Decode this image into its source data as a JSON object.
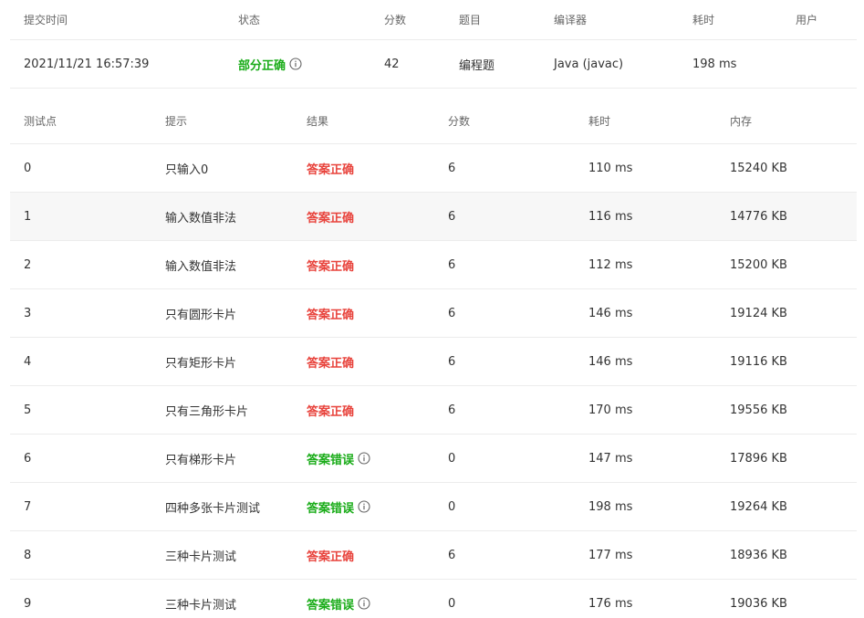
{
  "summary": {
    "headers": {
      "submit_time": "提交时间",
      "status": "状态",
      "score": "分数",
      "problem": "题目",
      "compiler": "编译器",
      "time": "耗时",
      "user": "用户"
    },
    "row": {
      "submit_time": "2021/11/21 16:57:39",
      "status": "部分正确",
      "score": "42",
      "problem": "编程题",
      "compiler": "Java (javac)",
      "time": "198 ms",
      "user": ""
    }
  },
  "cases": {
    "headers": {
      "id": "测试点",
      "hint": "提示",
      "result": "结果",
      "score": "分数",
      "time": "耗时",
      "memory": "内存"
    },
    "rows": [
      {
        "id": "0",
        "hint": "只输入0",
        "result": "答案正确",
        "score": "6",
        "time": "110 ms",
        "memory": "15240 KB"
      },
      {
        "id": "1",
        "hint": "输入数值非法",
        "result": "答案正确",
        "score": "6",
        "time": "116 ms",
        "memory": "14776 KB"
      },
      {
        "id": "2",
        "hint": "输入数值非法",
        "result": "答案正确",
        "score": "6",
        "time": "112 ms",
        "memory": "15200 KB"
      },
      {
        "id": "3",
        "hint": "只有圆形卡片",
        "result": "答案正确",
        "score": "6",
        "time": "146 ms",
        "memory": "19124 KB"
      },
      {
        "id": "4",
        "hint": "只有矩形卡片",
        "result": "答案正确",
        "score": "6",
        "time": "146 ms",
        "memory": "19116 KB"
      },
      {
        "id": "5",
        "hint": "只有三角形卡片",
        "result": "答案正确",
        "score": "6",
        "time": "170 ms",
        "memory": "19556 KB"
      },
      {
        "id": "6",
        "hint": "只有梯形卡片",
        "result": "答案错误",
        "score": "0",
        "time": "147 ms",
        "memory": "17896 KB"
      },
      {
        "id": "7",
        "hint": "四种多张卡片测试",
        "result": "答案错误",
        "score": "0",
        "time": "198 ms",
        "memory": "19264 KB"
      },
      {
        "id": "8",
        "hint": "三种卡片测试",
        "result": "答案正确",
        "score": "6",
        "time": "177 ms",
        "memory": "18936 KB"
      },
      {
        "id": "9",
        "hint": "三种卡片测试",
        "result": "答案错误",
        "score": "0",
        "time": "176 ms",
        "memory": "19036 KB"
      }
    ]
  },
  "colors": {
    "correct": "#e8433c",
    "wrong": "#1aac19",
    "partial": "#1aac19",
    "row_highlight": "#f7f7f7",
    "divider": "#ececec"
  }
}
